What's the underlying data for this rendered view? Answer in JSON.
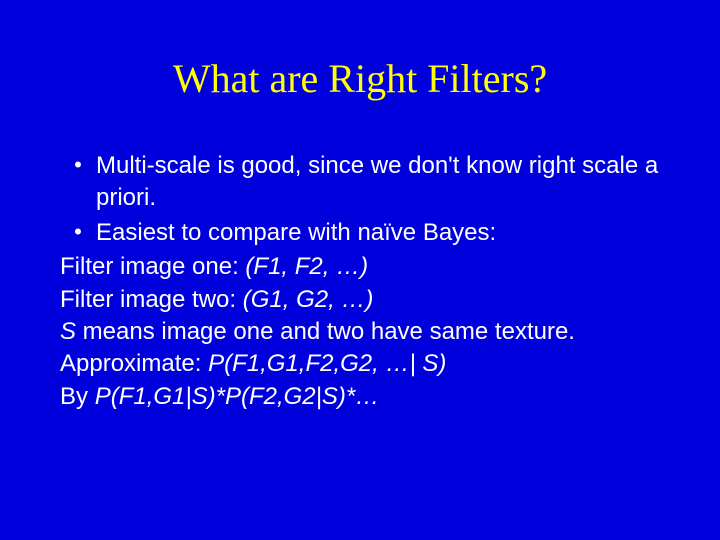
{
  "slide": {
    "title": "What are Right Filters?",
    "bullets": [
      "Multi-scale is good, since we don't know right scale a priori.",
      "Easiest to compare with naïve Bayes:"
    ],
    "lines": {
      "l1a": "Filter image one: ",
      "l1b": "(F1, F2, …)",
      "l2a": "Filter image two: ",
      "l2b": "(G1, G2, …)",
      "l3a": "S",
      "l3b": " means image one and two have same texture.",
      "l4a": "Approximate: ",
      "l4b": "P(F1,G1,F2,G2, …| S)",
      "l5a": "By ",
      "l5b": "P(F1,G1|S)*P(F2,G2|S)*…"
    }
  }
}
